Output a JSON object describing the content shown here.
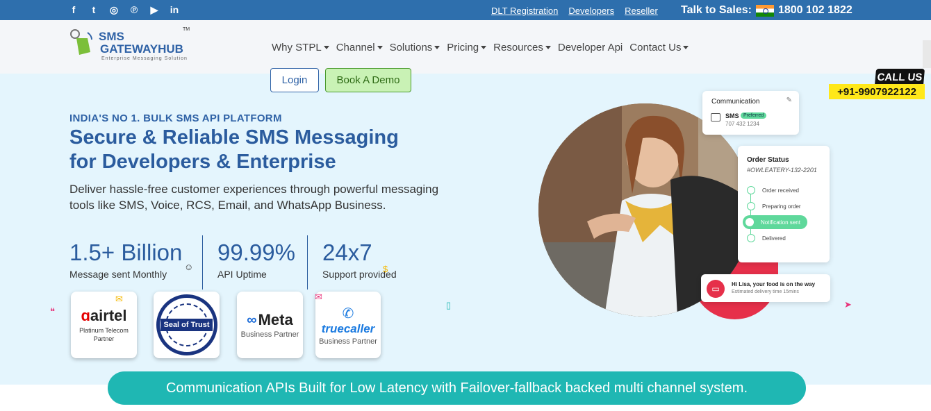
{
  "topbar": {
    "social": [
      {
        "name": "facebook-icon",
        "glyph": "f"
      },
      {
        "name": "twitter-icon",
        "glyph": "t"
      },
      {
        "name": "instagram-icon",
        "glyph": "◎"
      },
      {
        "name": "pinterest-icon",
        "glyph": "℗"
      },
      {
        "name": "youtube-icon",
        "glyph": "▶"
      },
      {
        "name": "linkedin-icon",
        "glyph": "in"
      }
    ],
    "links": [
      "DLT Registration",
      "Developers",
      "Reseller"
    ],
    "talk_label": "Talk to Sales:",
    "phone": "1800 102 1822"
  },
  "logo": {
    "line1": "SMS",
    "line2": "GATEWAYHUB",
    "tagline": "Enterprise Messaging Solution",
    "tm": "TM"
  },
  "nav": [
    {
      "label": "Why STPL",
      "dropdown": true
    },
    {
      "label": "Channel",
      "dropdown": true
    },
    {
      "label": "Solutions",
      "dropdown": true
    },
    {
      "label": "Pricing",
      "dropdown": true
    },
    {
      "label": "Resources",
      "dropdown": true
    },
    {
      "label": "Developer Api",
      "dropdown": false
    },
    {
      "label": "Contact Us",
      "dropdown": true
    }
  ],
  "buttons": {
    "login": "Login",
    "demo": "Book A Demo"
  },
  "callus": {
    "label": "CALL US",
    "phone": "+91-9907922122"
  },
  "hero": {
    "eyebrow": "INDIA'S NO 1. BULK SMS API PLATFORM",
    "headline_line1": "Secure & Reliable SMS Messaging",
    "headline_line2": "for Developers & Enterprise",
    "sub": "Deliver hassle-free customer experiences through powerful messaging tools like SMS, Voice, RCS, Email, and WhatsApp Business."
  },
  "stats": [
    {
      "num": "1.5+ Billion",
      "label": "Message sent Monthly"
    },
    {
      "num": "99.99%",
      "label": "API Uptime"
    },
    {
      "num": "24x7",
      "label": "Support provided"
    }
  ],
  "badges": {
    "airtel": {
      "logo": "airtel",
      "caption1": "Platinum Telecom",
      "caption2": "Partner"
    },
    "seal": {
      "text": "Seal of Trust",
      "ring": "100% Money back Guarantee"
    },
    "meta": {
      "logo": "Meta",
      "caption": "Business Partner"
    },
    "truecaller": {
      "logo": "truecaller",
      "caption": "Business Partner"
    }
  },
  "cards": {
    "communication": {
      "title": "Communication",
      "channel": "SMS",
      "tag": "Preferred",
      "number": "707 432 1234"
    },
    "order": {
      "title": "Order Status",
      "code": "#OWLEATERY-132-2201",
      "steps": [
        "Order received",
        "Preparing order",
        "Notification sent",
        "Delivered"
      ]
    },
    "notification": {
      "title": "Hi Lisa, your food is on the way",
      "sub": "Estimated delivery time 15mins"
    }
  },
  "banner": "Communication APIs Built for Low Latency with Failover-fallback backed multi channel system.",
  "colors": {
    "brand_blue": "#2b5c9e",
    "teal": "#1fb7b3",
    "accent_green": "#5fd89b",
    "red": "#e6304a"
  }
}
